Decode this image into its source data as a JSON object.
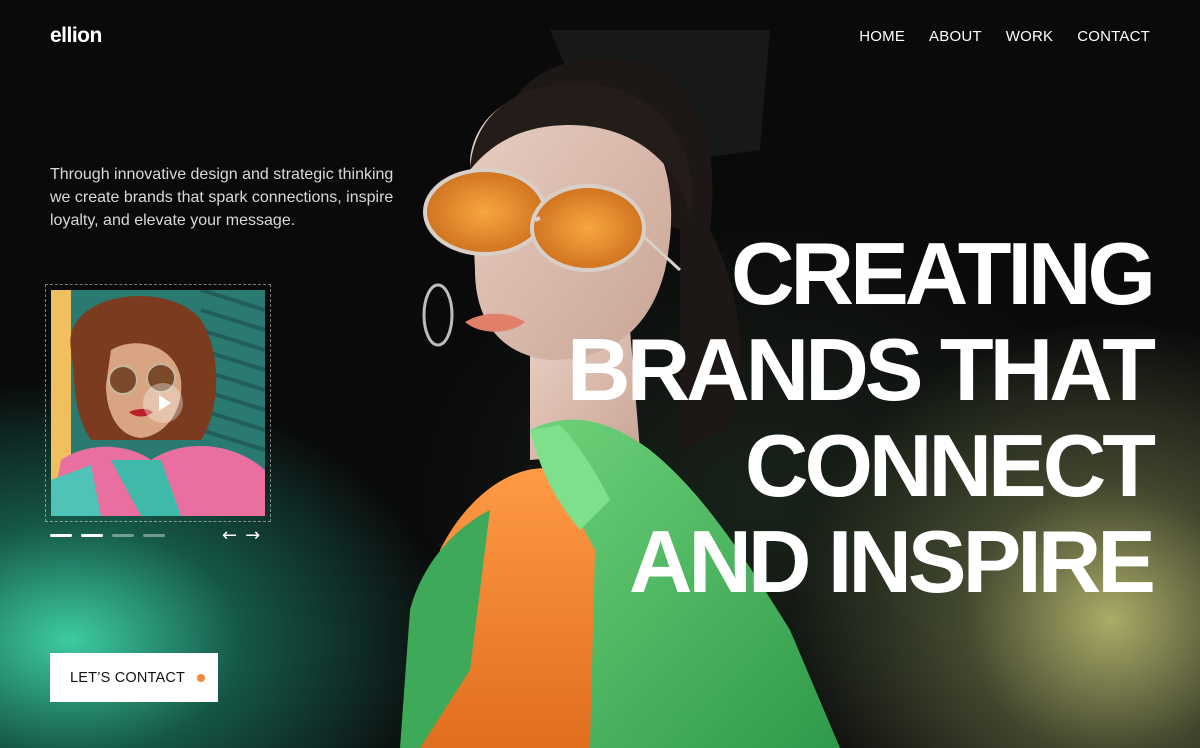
{
  "brand": {
    "logo": "ellion"
  },
  "nav": {
    "items": [
      "HOME",
      "ABOUT",
      "WORK",
      "CONTACT"
    ]
  },
  "intro": {
    "text": "Through innovative design and strategic thinking we create brands that spark connections, inspire loyalty, and elevate your message."
  },
  "hero": {
    "headline_lines": [
      "CREATING",
      "BRANDS THAT",
      "CONNECT",
      "AND INSPIRE"
    ]
  },
  "video": {
    "play_icon": "play-icon"
  },
  "slider": {
    "total": 4,
    "active": 2
  },
  "cta": {
    "label": "LET’S CONTACT",
    "dot_color": "#f08a3a"
  },
  "colors": {
    "background": "#0a0a0b",
    "accent_green": "#40d6aa",
    "accent_orange": "#f08a3a",
    "jacket_green": "#5ac96a"
  }
}
